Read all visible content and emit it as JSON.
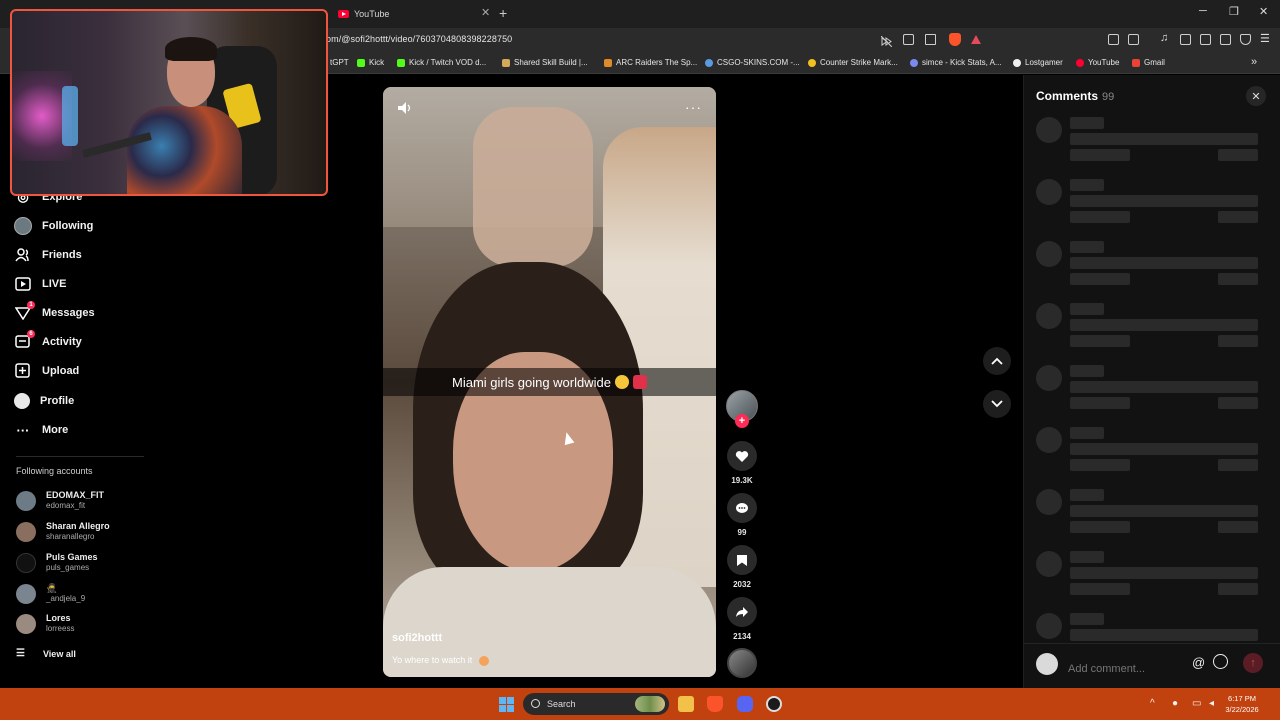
{
  "browser": {
    "tabs": [
      {
        "label": "YouTube",
        "icon": "youtube-icon"
      }
    ],
    "url": "om/@sofi2hottt/video/7603704808398228750",
    "bookmarks": [
      {
        "label": "tGPT",
        "color": "#cccccc"
      },
      {
        "label": "Kick",
        "color": "#53fc18"
      },
      {
        "label": "Kick / Twitch VOD d...",
        "color": "#53fc18"
      },
      {
        "label": "Shared Skill Build |...",
        "color": "#d4a85a"
      },
      {
        "label": "ARC Raiders The Sp...",
        "color": "#e08a2a"
      },
      {
        "label": "CSGO-SKINS.COM -...",
        "color": "#5a9be0"
      },
      {
        "label": "Counter Strike Mark...",
        "color": "#f0c020"
      },
      {
        "label": "simce - Kick Stats, A...",
        "color": "#7a8af0"
      },
      {
        "label": "Lostgamer",
        "color": "#eeeeee"
      },
      {
        "label": "YouTube",
        "color": "#ff0033"
      },
      {
        "label": "Gmail",
        "color": "#ea4335"
      }
    ]
  },
  "sidebar": {
    "items": [
      {
        "label": "Explore",
        "icon": "compass-icon"
      },
      {
        "label": "Following",
        "icon": "avatar-icon"
      },
      {
        "label": "Friends",
        "icon": "friends-icon"
      },
      {
        "label": "LIVE",
        "icon": "live-icon"
      },
      {
        "label": "Messages",
        "icon": "messages-icon",
        "badge": "1"
      },
      {
        "label": "Activity",
        "icon": "activity-icon",
        "badge": "6"
      },
      {
        "label": "Upload",
        "icon": "upload-icon"
      },
      {
        "label": "Profile",
        "icon": "profile-icon"
      },
      {
        "label": "More",
        "icon": "more-icon"
      }
    ],
    "following_title": "Following accounts",
    "following": [
      {
        "name": "EDOMAX_FIT",
        "user": "edomax_fit"
      },
      {
        "name": "Sharan Allegro",
        "user": "sharanallegro"
      },
      {
        "name": "Puls Games",
        "user": "puls_games"
      },
      {
        "name": "🥷",
        "user": "_andjela_9"
      },
      {
        "name": "Lores",
        "user": "lorreess"
      }
    ],
    "view_all": "View all"
  },
  "video": {
    "caption": "Miami girls going worldwide",
    "author": "sofi2hottt",
    "description": "Yo where to watch it"
  },
  "actions": {
    "likes": "19.3K",
    "comments": "99",
    "saves": "2032",
    "shares": "2134"
  },
  "comments_panel": {
    "title": "Comments",
    "count": "99",
    "placeholder": "Add comment...",
    "at_symbol": "@"
  },
  "taskbar": {
    "search_label": "Search",
    "time": "6:17 PM",
    "date": "3/22/2026"
  }
}
